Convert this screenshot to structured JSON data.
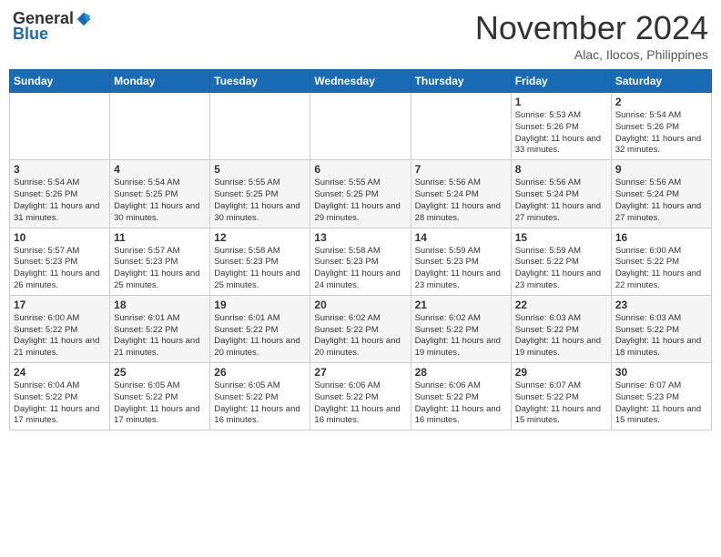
{
  "header": {
    "logo_general": "General",
    "logo_blue": "Blue",
    "month_title": "November 2024",
    "location": "Alac, Ilocos, Philippines"
  },
  "days_of_week": [
    "Sunday",
    "Monday",
    "Tuesday",
    "Wednesday",
    "Thursday",
    "Friday",
    "Saturday"
  ],
  "weeks": [
    [
      {
        "day": "",
        "info": ""
      },
      {
        "day": "",
        "info": ""
      },
      {
        "day": "",
        "info": ""
      },
      {
        "day": "",
        "info": ""
      },
      {
        "day": "",
        "info": ""
      },
      {
        "day": "1",
        "info": "Sunrise: 5:53 AM\nSunset: 5:26 PM\nDaylight: 11 hours and 33 minutes."
      },
      {
        "day": "2",
        "info": "Sunrise: 5:54 AM\nSunset: 5:26 PM\nDaylight: 11 hours and 32 minutes."
      }
    ],
    [
      {
        "day": "3",
        "info": "Sunrise: 5:54 AM\nSunset: 5:26 PM\nDaylight: 11 hours and 31 minutes."
      },
      {
        "day": "4",
        "info": "Sunrise: 5:54 AM\nSunset: 5:25 PM\nDaylight: 11 hours and 30 minutes."
      },
      {
        "day": "5",
        "info": "Sunrise: 5:55 AM\nSunset: 5:25 PM\nDaylight: 11 hours and 30 minutes."
      },
      {
        "day": "6",
        "info": "Sunrise: 5:55 AM\nSunset: 5:25 PM\nDaylight: 11 hours and 29 minutes."
      },
      {
        "day": "7",
        "info": "Sunrise: 5:56 AM\nSunset: 5:24 PM\nDaylight: 11 hours and 28 minutes."
      },
      {
        "day": "8",
        "info": "Sunrise: 5:56 AM\nSunset: 5:24 PM\nDaylight: 11 hours and 27 minutes."
      },
      {
        "day": "9",
        "info": "Sunrise: 5:56 AM\nSunset: 5:24 PM\nDaylight: 11 hours and 27 minutes."
      }
    ],
    [
      {
        "day": "10",
        "info": "Sunrise: 5:57 AM\nSunset: 5:23 PM\nDaylight: 11 hours and 26 minutes."
      },
      {
        "day": "11",
        "info": "Sunrise: 5:57 AM\nSunset: 5:23 PM\nDaylight: 11 hours and 25 minutes."
      },
      {
        "day": "12",
        "info": "Sunrise: 5:58 AM\nSunset: 5:23 PM\nDaylight: 11 hours and 25 minutes."
      },
      {
        "day": "13",
        "info": "Sunrise: 5:58 AM\nSunset: 5:23 PM\nDaylight: 11 hours and 24 minutes."
      },
      {
        "day": "14",
        "info": "Sunrise: 5:59 AM\nSunset: 5:23 PM\nDaylight: 11 hours and 23 minutes."
      },
      {
        "day": "15",
        "info": "Sunrise: 5:59 AM\nSunset: 5:22 PM\nDaylight: 11 hours and 23 minutes."
      },
      {
        "day": "16",
        "info": "Sunrise: 6:00 AM\nSunset: 5:22 PM\nDaylight: 11 hours and 22 minutes."
      }
    ],
    [
      {
        "day": "17",
        "info": "Sunrise: 6:00 AM\nSunset: 5:22 PM\nDaylight: 11 hours and 21 minutes."
      },
      {
        "day": "18",
        "info": "Sunrise: 6:01 AM\nSunset: 5:22 PM\nDaylight: 11 hours and 21 minutes."
      },
      {
        "day": "19",
        "info": "Sunrise: 6:01 AM\nSunset: 5:22 PM\nDaylight: 11 hours and 20 minutes."
      },
      {
        "day": "20",
        "info": "Sunrise: 6:02 AM\nSunset: 5:22 PM\nDaylight: 11 hours and 20 minutes."
      },
      {
        "day": "21",
        "info": "Sunrise: 6:02 AM\nSunset: 5:22 PM\nDaylight: 11 hours and 19 minutes."
      },
      {
        "day": "22",
        "info": "Sunrise: 6:03 AM\nSunset: 5:22 PM\nDaylight: 11 hours and 19 minutes."
      },
      {
        "day": "23",
        "info": "Sunrise: 6:03 AM\nSunset: 5:22 PM\nDaylight: 11 hours and 18 minutes."
      }
    ],
    [
      {
        "day": "24",
        "info": "Sunrise: 6:04 AM\nSunset: 5:22 PM\nDaylight: 11 hours and 17 minutes."
      },
      {
        "day": "25",
        "info": "Sunrise: 6:05 AM\nSunset: 5:22 PM\nDaylight: 11 hours and 17 minutes."
      },
      {
        "day": "26",
        "info": "Sunrise: 6:05 AM\nSunset: 5:22 PM\nDaylight: 11 hours and 16 minutes."
      },
      {
        "day": "27",
        "info": "Sunrise: 6:06 AM\nSunset: 5:22 PM\nDaylight: 11 hours and 16 minutes."
      },
      {
        "day": "28",
        "info": "Sunrise: 6:06 AM\nSunset: 5:22 PM\nDaylight: 11 hours and 16 minutes."
      },
      {
        "day": "29",
        "info": "Sunrise: 6:07 AM\nSunset: 5:22 PM\nDaylight: 11 hours and 15 minutes."
      },
      {
        "day": "30",
        "info": "Sunrise: 6:07 AM\nSunset: 5:23 PM\nDaylight: 11 hours and 15 minutes."
      }
    ]
  ]
}
